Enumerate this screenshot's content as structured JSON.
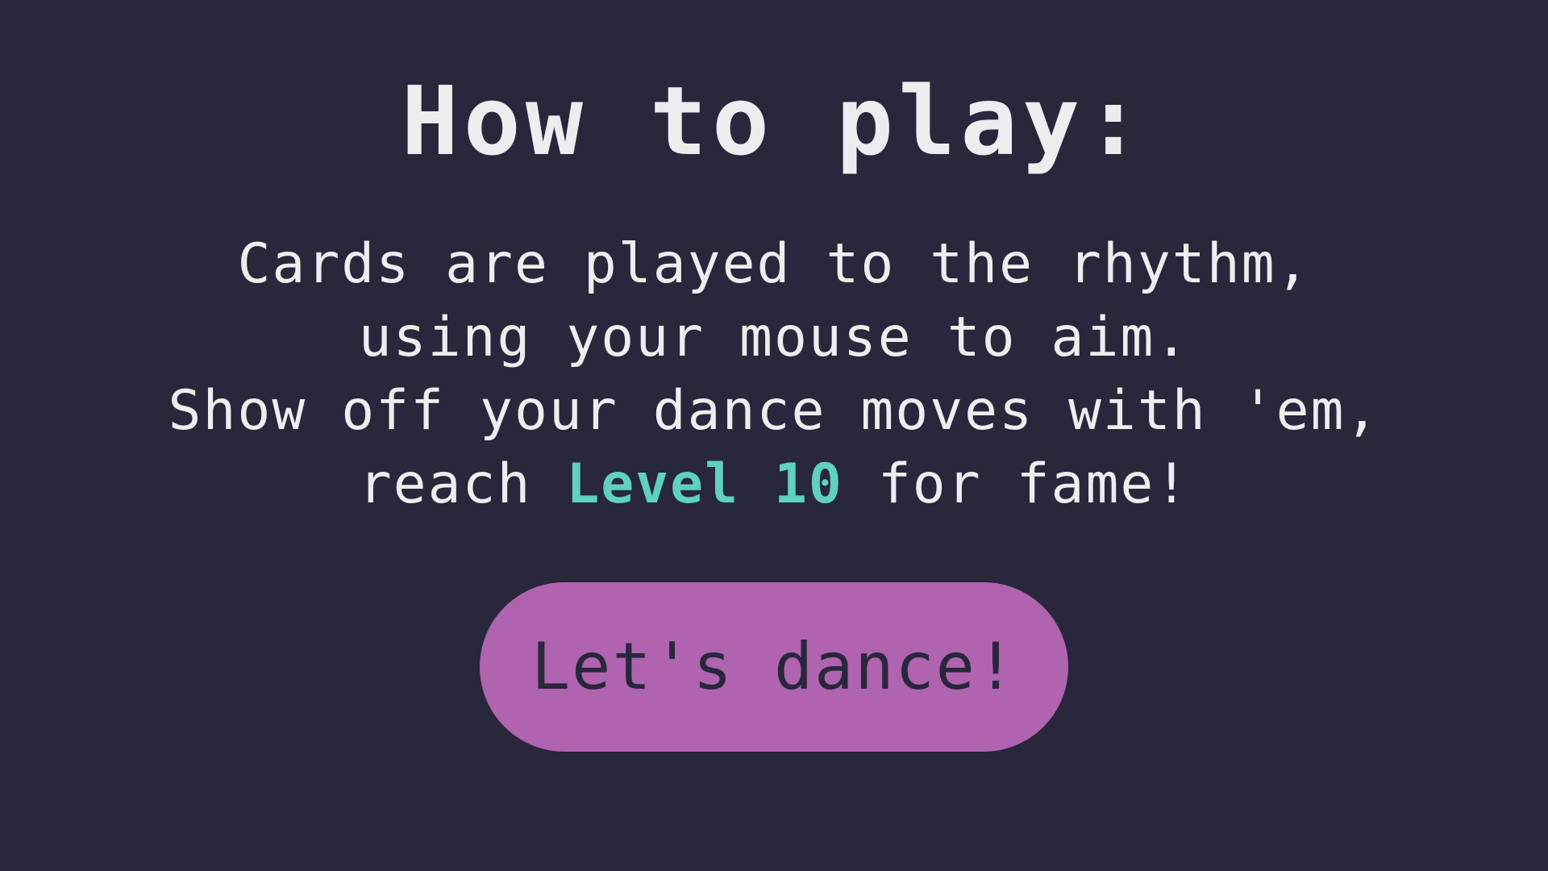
{
  "title": "How to play:",
  "instructions": {
    "line1": "Cards are played to the rhythm,",
    "line2": "using your mouse to aim.",
    "line3": "Show off your dance moves with 'em,",
    "line4_prefix": "reach ",
    "line4_highlight": "Level 10",
    "line4_suffix": " for fame!"
  },
  "start_button": {
    "label": "Let's dance!"
  },
  "colors": {
    "background": "#28273b",
    "text": "#ededef",
    "highlight": "#5fd1be",
    "button": "#b063ae",
    "button_text": "#28273b"
  }
}
